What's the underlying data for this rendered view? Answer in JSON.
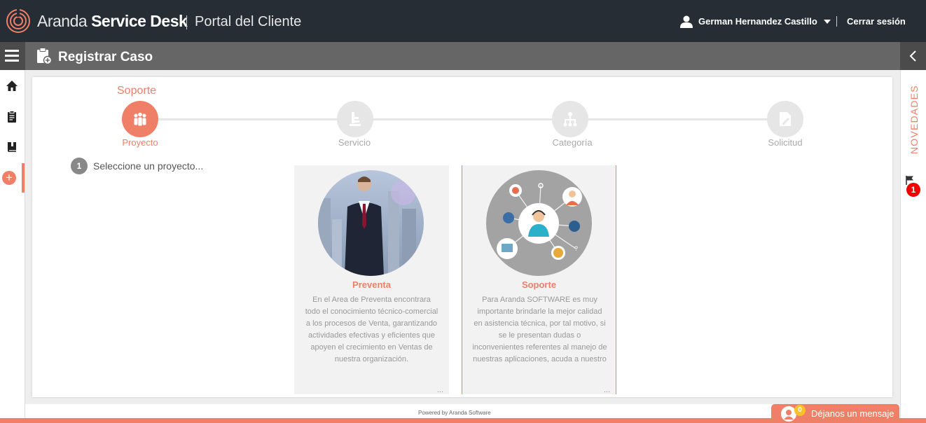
{
  "header": {
    "brand_light": "Aranda ",
    "brand_bold": "Service Desk",
    "portal": "Portal del Cliente",
    "user_name": "German Hernandez Castillo",
    "logout": "Cerrar sesión"
  },
  "subheader": {
    "title": "Registrar Caso"
  },
  "wizard": {
    "current_title": "Soporte",
    "steps": [
      {
        "label": "Proyecto",
        "icon": "group-icon",
        "active": true
      },
      {
        "label": "Servicio",
        "icon": "service-icon",
        "active": false
      },
      {
        "label": "Categoría",
        "icon": "hierarchy-icon",
        "active": false
      },
      {
        "label": "Solicitud",
        "icon": "edit-document-icon",
        "active": false
      }
    ],
    "instruction_number": "1",
    "instruction": "Seleccione un proyecto..."
  },
  "projects": [
    {
      "name": "Preventa",
      "description": "En el Area de Preventa encontrara todo el conocimiento técnico-comercial a los procesos de Venta, garantizando actividades efectivas y eficientes que apoyen el crecimiento en Ventas de nuestra organización.",
      "more": "...",
      "selected": false
    },
    {
      "name": "Soporte",
      "description": "Para Aranda SOFTWARE es muy importante brindarle la mejor calidad en asistencia técnica, por tal motivo, si se le presentan dudas o inconvenientes referentes al manejo de nuestras aplicaciones, acuda a nuestro",
      "more": "...",
      "selected": true
    }
  ],
  "right_panel": {
    "label": "NOVEDADES",
    "notifications": "1"
  },
  "footer": {
    "powered": "Powered by Aranda Software",
    "chat_label": "Déjanos un mensaje",
    "chat_count": "0"
  },
  "colors": {
    "accent": "#f07f68",
    "topbar": "#262d35",
    "subbar": "#666666"
  }
}
